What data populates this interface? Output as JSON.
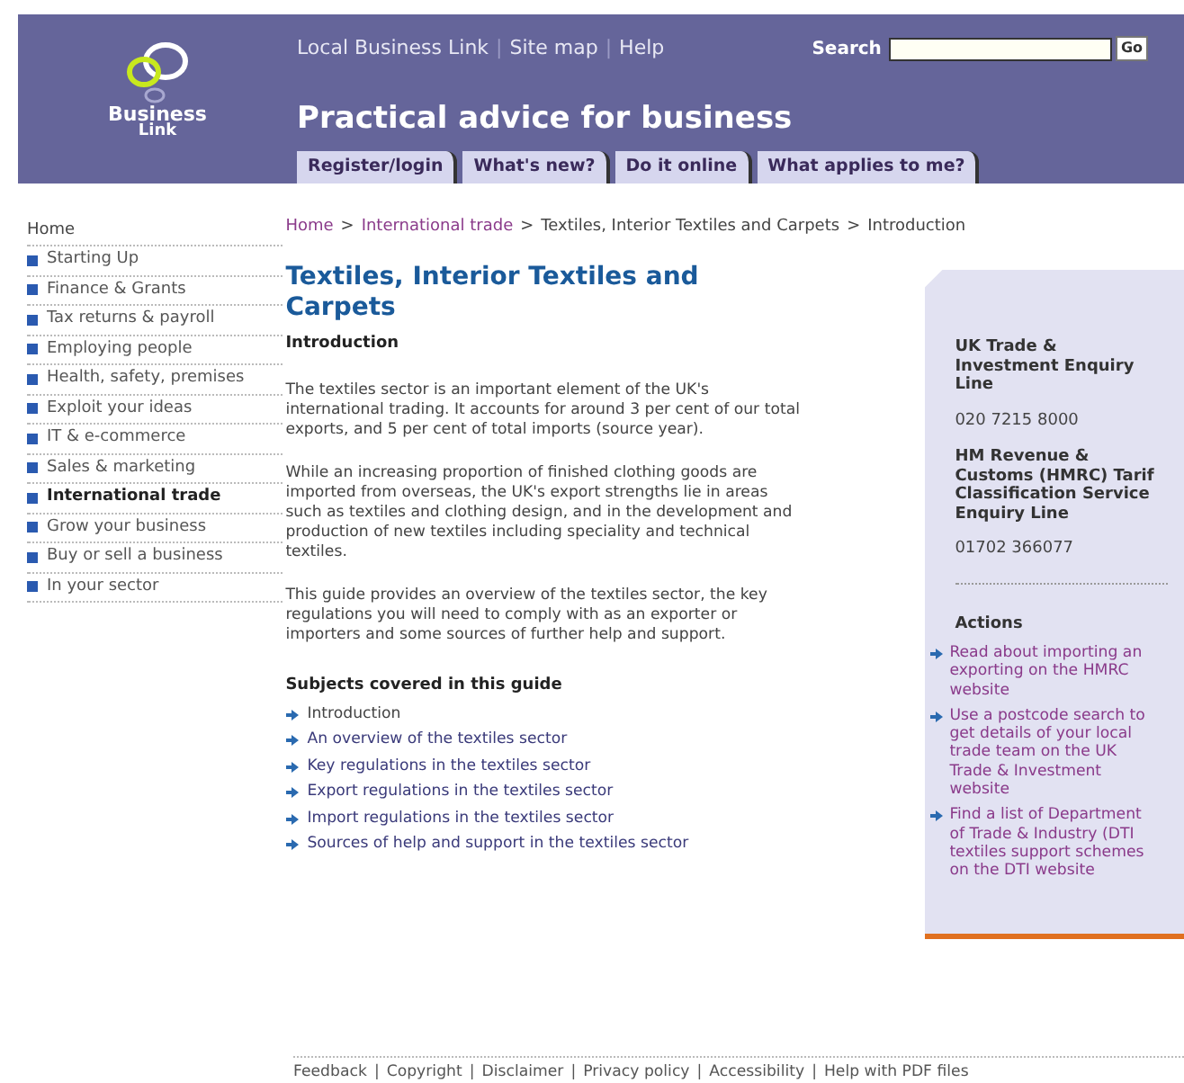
{
  "header": {
    "logo_text": "Business",
    "logo_subtext": "Link",
    "top_links": [
      "Local Business Link",
      "Site map",
      "Help"
    ],
    "top_link_separator": "|",
    "search": {
      "label": "Search",
      "button": "Go"
    },
    "tagline": "Practical advice for business",
    "tabs": [
      "Register/login",
      "What's new?",
      "Do it online",
      "What applies to me?"
    ]
  },
  "sidebar": {
    "home": "Home",
    "items": [
      {
        "label": "Starting Up",
        "selected": false
      },
      {
        "label": "Finance & Grants",
        "selected": false
      },
      {
        "label": "Tax returns & payroll",
        "selected": false
      },
      {
        "label": "Employing people",
        "selected": false
      },
      {
        "label": "Health, safety, premises",
        "selected": false
      },
      {
        "label": "Exploit your ideas",
        "selected": false
      },
      {
        "label": "IT & e-commerce",
        "selected": false
      },
      {
        "label": "Sales & marketing",
        "selected": false
      },
      {
        "label": "International trade",
        "selected": true
      },
      {
        "label": "Grow your business",
        "selected": false
      },
      {
        "label": "Buy or sell a business",
        "selected": false
      },
      {
        "label": "In your sector",
        "selected": false
      }
    ]
  },
  "breadcrumb": [
    {
      "label": "Home",
      "link": true
    },
    {
      "label": "International trade",
      "link": true
    },
    {
      "label": "Textiles, Interior Textiles and Carpets",
      "link": false
    },
    {
      "label": "Introduction",
      "link": false
    }
  ],
  "breadcrumb_separator": ">",
  "title": "Textiles, Interior Textiles and Carpets",
  "subtitle": "Introduction",
  "paragraphs": [
    "The textiles sector is an important element of the UK's international trading. It accounts for around 3 per cent of our total exports, and 5 per cent of total imports (source year).",
    "While an increasing proportion of finished clothing goods are imported from overseas, the UK's export strengths lie in areas such as textiles and clothing design, and in the development and production of new textiles including speciality and technical textiles.",
    "This guide provides an overview of the textiles sector, the key regulations you will need to comply with as an exporter or importers and some sources of further help and support."
  ],
  "subjects": {
    "heading": "Subjects covered in this guide",
    "items": [
      {
        "label": "Introduction",
        "selected": true
      },
      {
        "label": "An overview of the textiles sector",
        "selected": false
      },
      {
        "label": "Key regulations in the textiles sector",
        "selected": false
      },
      {
        "label": "Export regulations in the textiles sector",
        "selected": false
      },
      {
        "label": "Import regulations in the textiles sector",
        "selected": false
      },
      {
        "label": "Sources of help and support in the textiles sector",
        "selected": false
      }
    ]
  },
  "contacts": [
    {
      "name_lines": [
        "UK Trade &",
        "Investment Enquiry",
        "Line"
      ],
      "phone": "020 7215 8000"
    },
    {
      "name_lines": [
        "HM Revenue &",
        "Customs (HMRC) Tarif",
        "Classification Service",
        "Enquiry Line"
      ],
      "phone": "01702 366077"
    }
  ],
  "actions": {
    "heading": "Actions",
    "items": [
      {
        "lines": [
          "Read about importing an",
          "exporting on the HMRC",
          "website"
        ]
      },
      {
        "lines": [
          "Use a postcode search to",
          "get details of your local",
          "trade team on the UK",
          "Trade & Investment",
          "website"
        ]
      },
      {
        "lines": [
          "Find a list of Department",
          "of Trade & Industry (DTI",
          "textiles support schemes",
          "on the DTI website"
        ]
      }
    ]
  },
  "footer_separator": "|",
  "footer": [
    "Feedback",
    "Copyright",
    "Disclaimer",
    "Privacy policy",
    "Accessibility",
    "Help with PDF files"
  ]
}
